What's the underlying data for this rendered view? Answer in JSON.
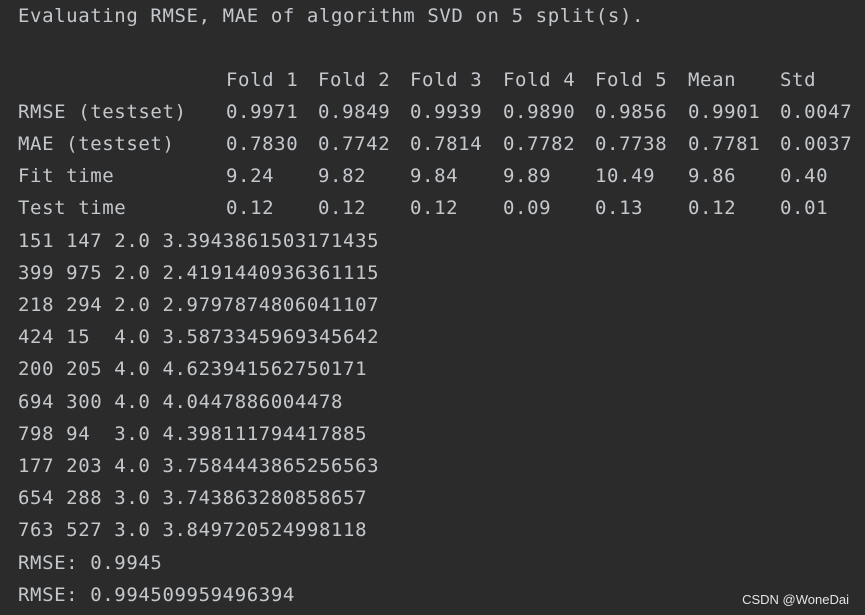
{
  "console": {
    "header_line": "Evaluating RMSE, MAE of algorithm SVD on 5 split(s).",
    "table": {
      "columns": [
        "Fold 1",
        "Fold 2",
        "Fold 3",
        "Fold 4",
        "Fold 5",
        "Mean",
        "Std"
      ],
      "rows": [
        {
          "label": "RMSE (testset)",
          "values": [
            "0.9971",
            "0.9849",
            "0.9939",
            "0.9890",
            "0.9856",
            "0.9901",
            "0.0047"
          ]
        },
        {
          "label": "MAE (testset)",
          "values": [
            "0.7830",
            "0.7742",
            "0.7814",
            "0.7782",
            "0.7738",
            "0.7781",
            "0.0037"
          ]
        },
        {
          "label": "Fit time",
          "values": [
            "9.24",
            "9.82",
            "9.84",
            "9.89",
            "10.49",
            "9.86",
            "0.40"
          ]
        },
        {
          "label": "Test time",
          "values": [
            "0.12",
            "0.12",
            "0.12",
            "0.09",
            "0.13",
            "0.12",
            "0.01"
          ]
        }
      ]
    },
    "prediction_lines": [
      "151 147 2.0 3.3943861503171435",
      "399 975 2.0 2.4191440936361115",
      "218 294 2.0 2.9797874806041107",
      "424 15  4.0 3.5873345969345642",
      "200 205 4.0 4.623941562750171",
      "694 300 4.0 4.0447886004478",
      "798 94  3.0 4.398111794417885",
      "177 203 4.0 3.7584443865256563",
      "654 288 3.0 3.743863280858657",
      "763 527 3.0 3.849720524998118"
    ],
    "rmse_lines": [
      "RMSE: 0.9945",
      "RMSE: 0.994509959496394"
    ]
  },
  "watermark": "CSDN @WoneDai"
}
